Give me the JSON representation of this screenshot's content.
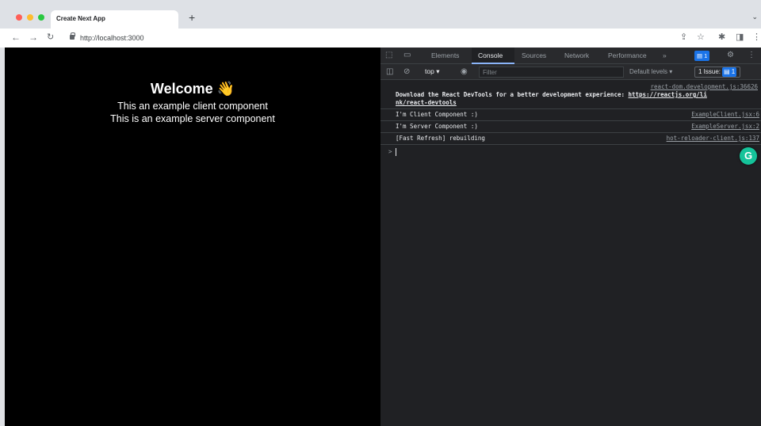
{
  "browser": {
    "tab_title": "Create Next App",
    "new_tab_icon": "+",
    "url": "http://localhost:3000",
    "icons": {
      "back": "arrow-left-icon",
      "forward": "arrow-right-icon",
      "reload": "reload-icon",
      "lock": "lock-icon",
      "share": "share-icon",
      "bookmark": "star-icon",
      "extensions": "puzzle-icon",
      "sidepanel": "sidepanel-icon",
      "menu": "kebab-menu-icon"
    }
  },
  "page": {
    "heading": "Welcome",
    "heading_emoji": "👋",
    "lines": [
      "This an example client component",
      "This is an example server component"
    ]
  },
  "devtools": {
    "tabs": [
      "Elements",
      "Console",
      "Sources",
      "Network",
      "Performance"
    ],
    "active_tab": "Console",
    "more_tabs": "»",
    "messages_badge": "1",
    "context": "top",
    "filter_placeholder": "Filter",
    "levels": "Default levels ▾",
    "issues_label": "1 Issue:",
    "issues_count": "1",
    "messages": [
      {
        "source": "react-dom.development.js:36626",
        "text": "Download the React DevTools for a better development experience: ",
        "link": "https://reactjs.org/link/react-devtools",
        "link_part1": "https://reactjs.org/li",
        "link_part2": "nk/react-devtools"
      },
      {
        "text": "I'm Client Component :)",
        "source": "ExampleClient.jsx:6"
      },
      {
        "text": "I'm Server Component :)",
        "source": "ExampleServer.jsx:2"
      },
      {
        "text": "[Fast Refresh] rebuilding",
        "source": "hot-reloader-client.js:137"
      }
    ],
    "prompt_symbol": ">"
  },
  "extension": {
    "grammarly_letter": "G"
  }
}
